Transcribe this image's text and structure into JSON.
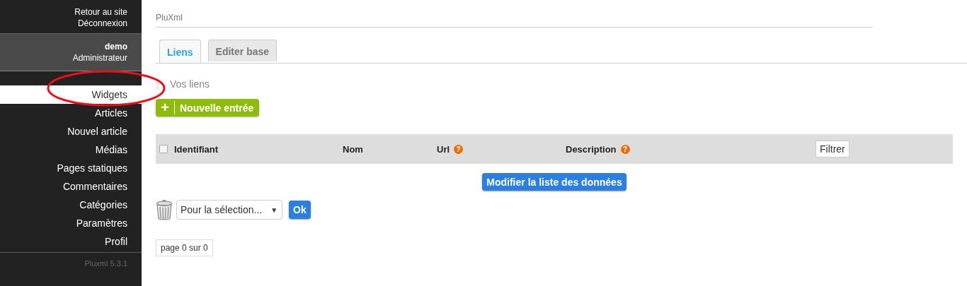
{
  "header_links": [
    "Retour au site",
    "Déconnexion"
  ],
  "user": {
    "name": "demo",
    "role": "Administrateur"
  },
  "menu": [
    {
      "label": "Widgets",
      "selected": true
    },
    {
      "label": "Articles",
      "selected": false
    },
    {
      "label": "Nouvel article",
      "selected": false
    },
    {
      "label": "Médias",
      "selected": false
    },
    {
      "label": "Pages statiques",
      "selected": false
    },
    {
      "label": "Commentaires",
      "selected": false
    },
    {
      "label": "Catégories",
      "selected": false
    },
    {
      "label": "Paramètres",
      "selected": false
    },
    {
      "label": "Profil",
      "selected": false
    }
  ],
  "version": "Pluxml 5.3.1",
  "breadcrumb": "PluXml",
  "tabs": [
    {
      "label": "Liens",
      "selected": true
    },
    {
      "label": "Editer base",
      "selected": false
    }
  ],
  "section_title": "Vos liens",
  "new_button": {
    "icon": "+",
    "label": "Nouvelle entrée"
  },
  "table": {
    "select_all_checked": false,
    "columns": [
      {
        "label": "Identifiant"
      },
      {
        "label": "Nom"
      },
      {
        "label": "Url",
        "help": "?"
      },
      {
        "label": "Description",
        "help": "?"
      }
    ],
    "filter_button": "Filtrer"
  },
  "modify_button": "Modifier la liste des données",
  "bulk_action": {
    "value": "Pour la sélection...",
    "caret": "▼",
    "button": "Ok"
  },
  "pagination": "page 0 sur 0"
}
